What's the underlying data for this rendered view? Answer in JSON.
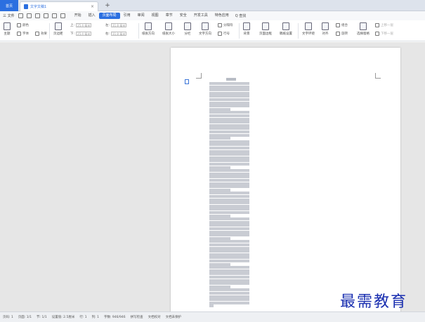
{
  "tabs": {
    "home": "首页",
    "document": "文字文稿1",
    "close": "×",
    "new": "+"
  },
  "menu": {
    "file": "三 文件",
    "items": [
      "开始",
      "插入",
      "页面布局",
      "引用",
      "审阅",
      "视图",
      "章节",
      "安全",
      "开发工具",
      "特色应用"
    ],
    "active_index": 2,
    "search": "Q 查找"
  },
  "ribbon": {
    "theme": "主题",
    "color": "颜色",
    "font": "字体",
    "effect": "效果",
    "margin": "页边距",
    "top_label": "上:",
    "top_value": "25.4 毫米",
    "bottom_label": "下:",
    "bottom_value": "25.4 毫米",
    "left_label": "左:",
    "left_value": "31.8 毫米",
    "right_label": "右:",
    "right_value": "31.8 毫米",
    "orientation": "纸张方向",
    "size": "纸张大小",
    "columns": "分栏",
    "text_direction": "文字方向",
    "separator": "分隔符",
    "line_number": "行号",
    "background": "背景",
    "page_border": "页面边框",
    "manuscript": "稿纸设置",
    "wrap": "文字环绕",
    "align": "对齐",
    "group": "组合",
    "rotate": "旋转",
    "select_pane": "选择窗格",
    "bring_forward": "上移一层",
    "send_backward": "下移一层"
  },
  "document": {
    "line_count": 70
  },
  "watermark": "最需教育",
  "status": {
    "page_no": "页码: 1",
    "pages": "页面: 1/1",
    "section": "节: 1/1",
    "position": "设置值: 2.5厘米",
    "row": "行: 1",
    "col": "列: 1",
    "word_count": "字数: 946/946",
    "spell": "拼写检查",
    "proofread": "文档校对",
    "protect": "文档未保护"
  },
  "colors": {
    "accent": "#2b6fe0",
    "watermark": "#1a2fb0"
  }
}
